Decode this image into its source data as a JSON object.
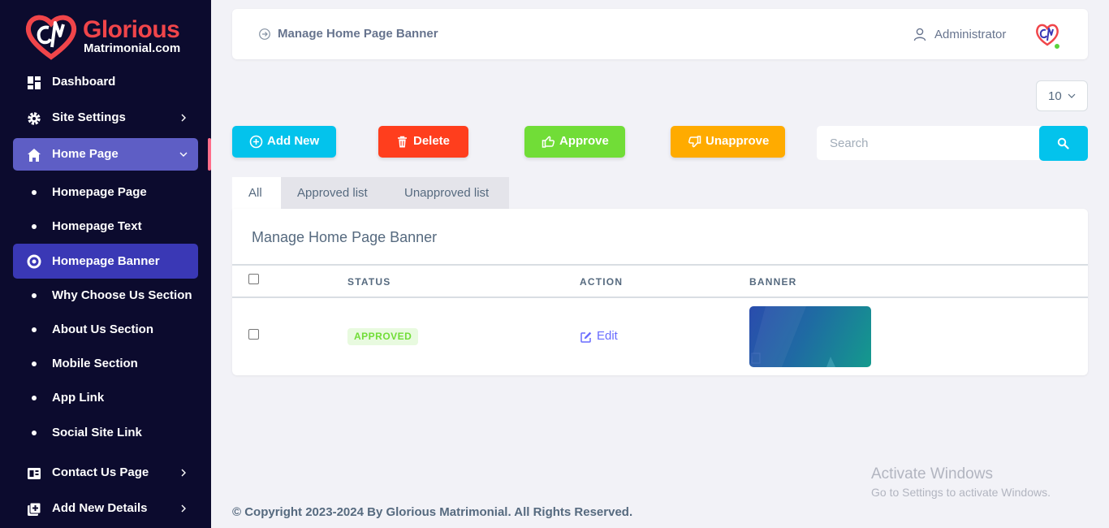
{
  "brand": {
    "name": "Glorious",
    "sub": "Matrimonial.com"
  },
  "sidebar": {
    "items": [
      {
        "label": "Dashboard",
        "icon": "dashboard-icon"
      },
      {
        "label": "Site Settings",
        "icon": "gear-icon"
      },
      {
        "label": "Home Page",
        "icon": "home-icon"
      },
      {
        "label": "Homepage Page"
      },
      {
        "label": "Homepage Text"
      },
      {
        "label": "Homepage Banner",
        "icon": "circle-icon"
      },
      {
        "label": "Why Choose Us Section"
      },
      {
        "label": "About Us Section"
      },
      {
        "label": "Mobile Section"
      },
      {
        "label": "App Link"
      },
      {
        "label": "Social Site Link"
      },
      {
        "label": "Contact Us Page",
        "icon": "contact-card-icon"
      },
      {
        "label": "Add New Details",
        "icon": "add-box-icon"
      }
    ]
  },
  "header": {
    "breadcrumb": "Manage Home Page Banner",
    "user": "Administrator"
  },
  "per_page": "10",
  "actions": {
    "add": "Add New",
    "delete": "Delete",
    "approve": "Approve",
    "unapprove": "Unapprove"
  },
  "search": {
    "placeholder": "Search"
  },
  "tabs": [
    "All",
    "Approved list",
    "Unapproved list"
  ],
  "table": {
    "title": "Manage Home Page Banner",
    "columns": [
      "STATUS",
      "ACTION",
      "BANNER"
    ],
    "rows": [
      {
        "status": "APPROVED",
        "action": "Edit"
      }
    ]
  },
  "watermark": {
    "title": "Activate Windows",
    "sub": "Go to Settings to activate Windows."
  },
  "footer": "© Copyright 2023-2024 By Glorious Matrimonial. All Rights Reserved.",
  "colors": {
    "sidebar_bg": "#0c0b2e",
    "add": "#03c3ec",
    "delete": "#ff3e1d",
    "approve": "#71dd37",
    "unapprove": "#ffab00",
    "accent": "#696cff"
  }
}
